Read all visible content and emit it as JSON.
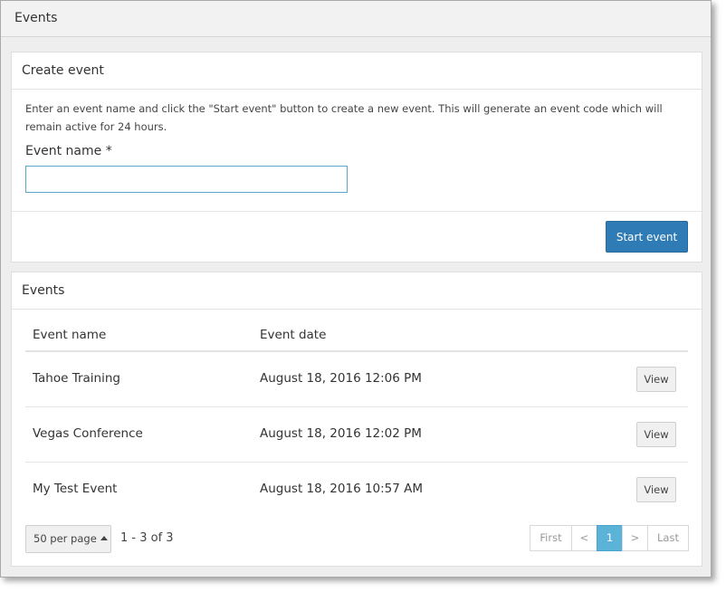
{
  "header": {
    "title": "Events"
  },
  "create_panel": {
    "title": "Create event",
    "description": "Enter an event name and click the \"Start event\" button to create a new event. This will generate an event code which will remain active for 24 hours.",
    "field_label": "Event name *",
    "event_name_value": "",
    "start_button": "Start event"
  },
  "events_panel": {
    "title": "Events",
    "columns": [
      "Event name",
      "Event date"
    ],
    "rows": [
      {
        "name": "Tahoe Training",
        "date": "August 18, 2016 12:06 PM",
        "action": "View"
      },
      {
        "name": "Vegas Conference",
        "date": "August 18, 2016 12:02 PM",
        "action": "View"
      },
      {
        "name": "My Test Event",
        "date": "August 18, 2016 10:57 AM",
        "action": "View"
      }
    ],
    "per_page": "50 per page",
    "count_text": "1 - 3 of 3",
    "pager": {
      "first": "First",
      "prev": "<",
      "current": "1",
      "next": ">",
      "last": "Last"
    }
  },
  "colors": {
    "primary_button": "#2e7bb6",
    "active_page": "#5bb4d8",
    "input_focus_border": "#5aa7c7"
  }
}
